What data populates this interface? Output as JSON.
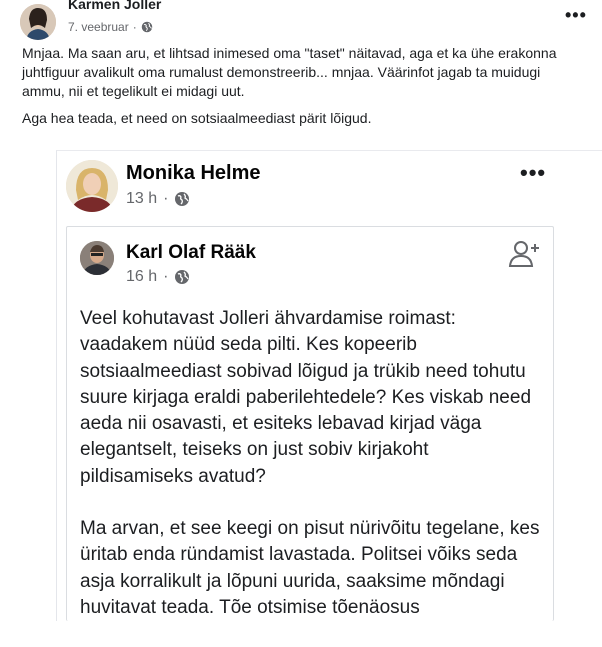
{
  "top_post": {
    "author": "Karmen Joller",
    "date": "7. veebruar",
    "paragraph1": "Mnjaa. Ma saan aru, et lihtsad inimesed oma \"taset\" näitavad, aga et ka ühe erakonna juhtfiguur avalikult oma rumalust demonstreerib... mnjaa. Väärinfot jagab ta muidugi ammu, nii et tegelikult ei midagi uut.",
    "paragraph2": "Aga hea teada, et need on sotsiaalmeediast pärit lõigud."
  },
  "shared_post": {
    "author": "Monika Helme",
    "time": "13 h"
  },
  "quoted_post": {
    "author": "Karl Olaf Rääk",
    "time": "16 h",
    "paragraph1": "Veel  kohutavast Jolleri  ähvardamise roimast: vaadakem nüüd seda pilti. Kes kopeerib sotsiaalmeediast sobivad lõigud ja trükib need tohutu suure kirjaga eraldi paberilehtedele? Kes viskab need aeda nii osavasti, et esiteks lebavad kirjad väga elegantselt, teiseks on just sobiv kirjakoht pildisamiseks avatud?",
    "paragraph2": "Ma arvan, et see keegi on pisut nürivõitu tegelane, kes üritab enda ründamist lavastada. Politsei võiks seda asja korralikult ja lõpuni uurida, saaksime mõndagi huvitavat teada. Tõe otsimise tõenäosus"
  },
  "icons": {
    "more": "more-options-icon",
    "audience": "globe-icon",
    "add_friend": "add-friend-icon"
  },
  "separator": "·",
  "more_glyph": "•••"
}
